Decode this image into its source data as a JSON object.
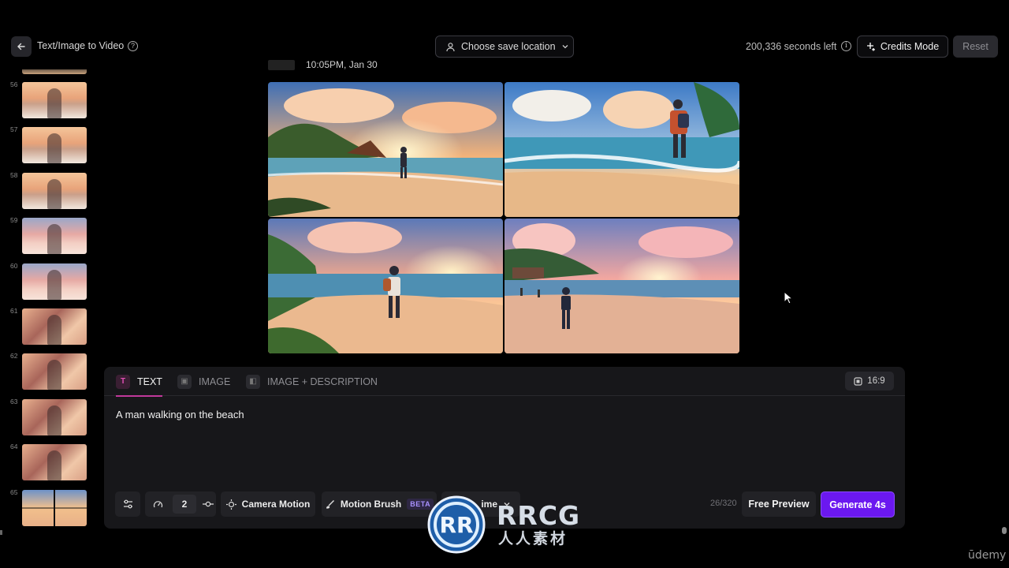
{
  "header": {
    "title": "Text/Image to Video",
    "save_location": "Choose save location",
    "seconds_left": "200,336 seconds left",
    "credits_mode": "Credits Mode",
    "reset": "Reset"
  },
  "sidebar": {
    "items": [
      {
        "num": "56",
        "style": "girl"
      },
      {
        "num": "57",
        "style": "girl"
      },
      {
        "num": "58",
        "style": "girl"
      },
      {
        "num": "59",
        "style": "pink"
      },
      {
        "num": "60",
        "style": "pink"
      },
      {
        "num": "61",
        "style": "closeup"
      },
      {
        "num": "62",
        "style": "closeup"
      },
      {
        "num": "63",
        "style": "closeup"
      },
      {
        "num": "64",
        "style": "closeup"
      },
      {
        "num": "65",
        "style": "beachgrid"
      }
    ]
  },
  "generation": {
    "timestamp": "10:05PM, Jan 30"
  },
  "composer": {
    "tabs": [
      {
        "label": "TEXT",
        "active": true
      },
      {
        "label": "IMAGE",
        "active": false
      },
      {
        "label": "IMAGE + DESCRIPTION",
        "active": false
      }
    ],
    "aspect_ratio": "16:9",
    "prompt": "A man walking on the beach",
    "count": "2",
    "camera_motion": "Camera Motion",
    "motion_brush": "Motion Brush",
    "beta": "BETA",
    "style_partial": "ime",
    "char_counter": "26/320",
    "free_preview": "Free Preview",
    "generate": "Generate 4s"
  },
  "watermark": {
    "brand": "RRCG",
    "sub": "人人素材",
    "udemy": "ūdemy"
  },
  "colors": {
    "accent": "#6b18f0",
    "tab_indicator": "#c0399b"
  }
}
